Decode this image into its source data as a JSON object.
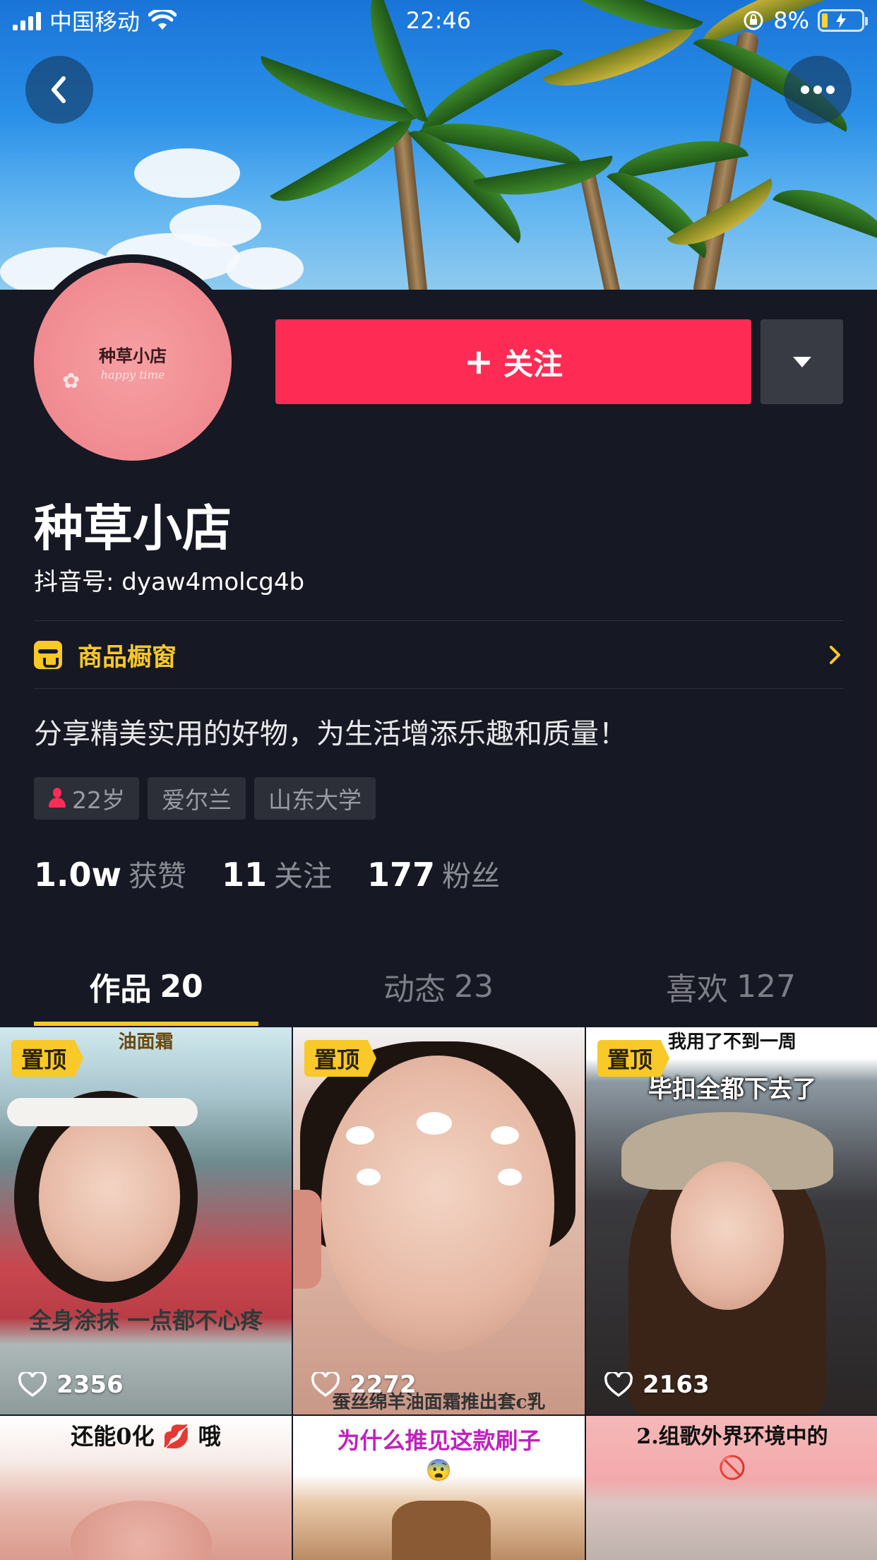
{
  "status_bar": {
    "carrier": "中国移动",
    "time": "22:46",
    "battery_text": "8%"
  },
  "profile": {
    "avatar_brand": "种草小店",
    "avatar_sub": "happy time",
    "follow_label": "关注",
    "follow_plus": "+",
    "name": "种草小店",
    "douyin_id": "抖音号: dyaw4molcg4b",
    "showcase_label": "商品橱窗",
    "bio": "分享精美实用的好物，为生活增添乐趣和质量！",
    "tags": {
      "age": "22岁",
      "country": "爱尔兰",
      "school": "山东大学"
    },
    "stats": {
      "likes_num": "1.0w",
      "likes_label": "获赞",
      "following_num": "11",
      "following_label": "关注",
      "fans_num": "177",
      "fans_label": "粉丝"
    }
  },
  "tabs": [
    {
      "label": "作品",
      "count": "20",
      "active": true
    },
    {
      "label": "动态",
      "count": "23",
      "active": false
    },
    {
      "label": "喜欢",
      "count": "127",
      "active": false
    }
  ],
  "videos": [
    {
      "pinned_label": "置顶",
      "likes": "2356",
      "caption_top": "油面霜",
      "caption": "全身涂抹 一点都不心疼"
    },
    {
      "pinned_label": "置顶",
      "likes": "2272",
      "caption": "蚕丝绵羊油面霜推出套c乳"
    },
    {
      "pinned_label": "置顶",
      "likes": "2163",
      "caption_top": "我用了不到一周",
      "caption": "毕扣全都下去了"
    },
    {
      "caption": "还能0化 💋 哦"
    },
    {
      "caption": "为什么推见这款刷子",
      "emoji": "😨"
    },
    {
      "caption": "2.组歌外界环境中的",
      "emoji": "🚫"
    }
  ],
  "colors": {
    "background": "#161823",
    "accent_red": "#fe2c55",
    "accent_yellow": "#f8c928"
  },
  "icons": {
    "back": "chevron-left-icon",
    "more": "ellipsis-icon",
    "dropdown": "triangle-down-icon",
    "showcase": "shop-icon",
    "like": "heart-outline-icon"
  }
}
